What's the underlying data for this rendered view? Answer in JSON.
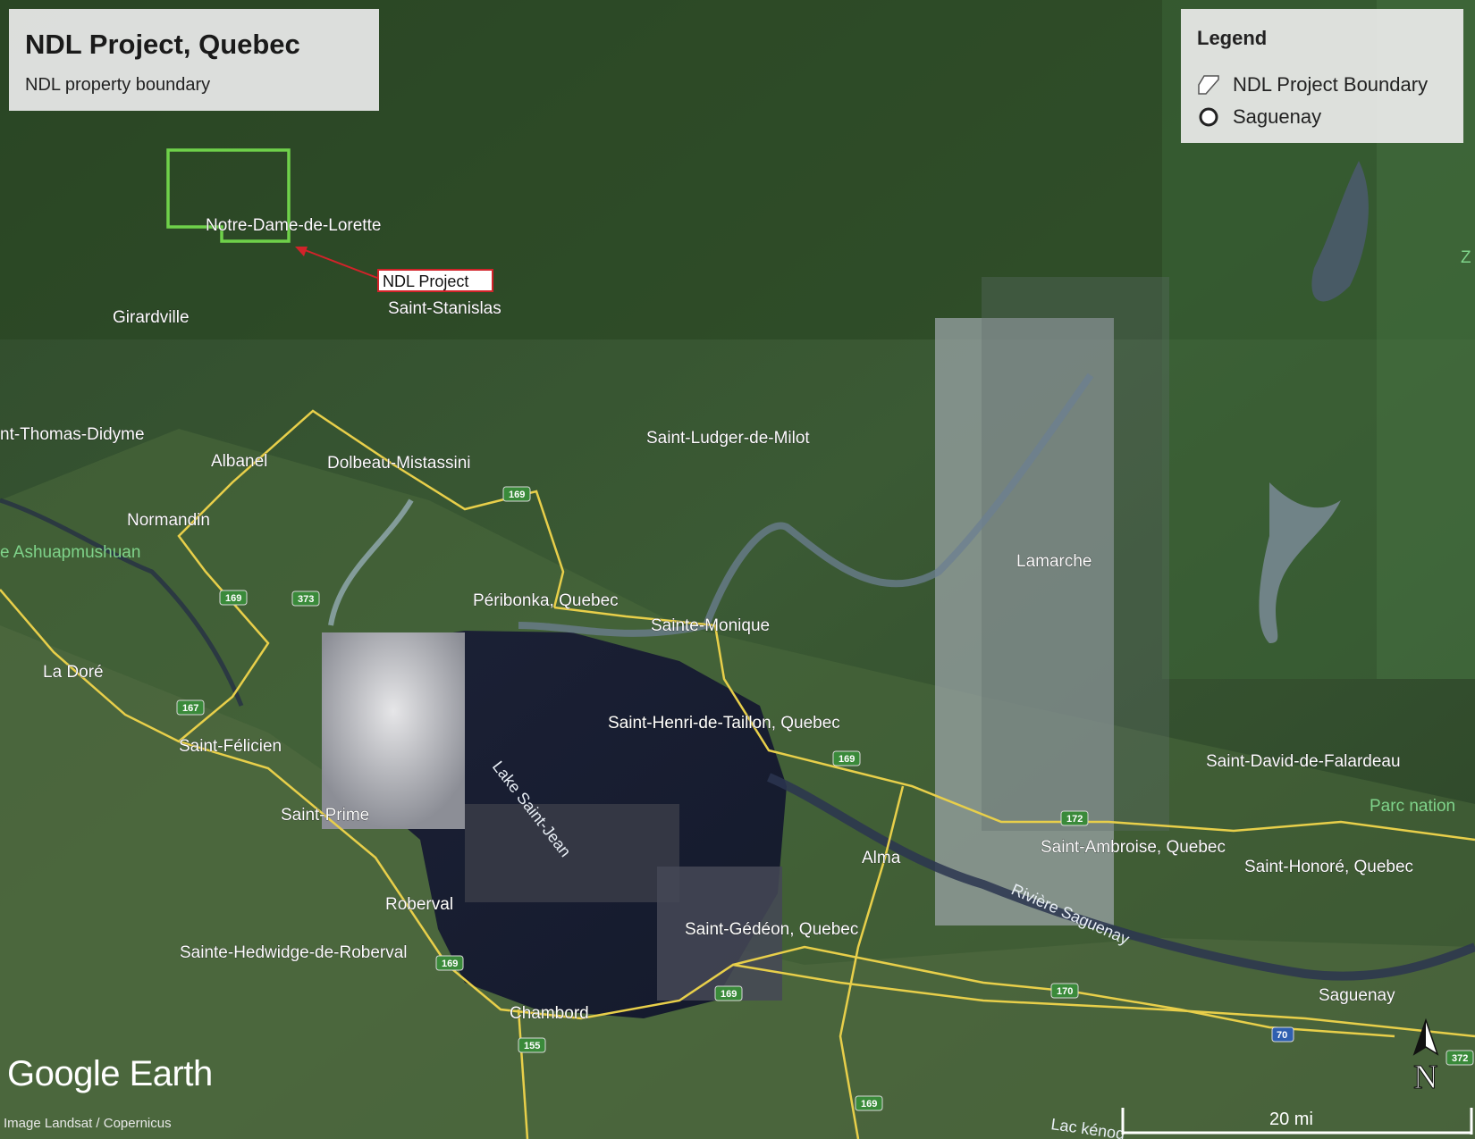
{
  "title": "NDL Project, Quebec",
  "subtitle": "NDL property boundary",
  "legend": {
    "title": "Legend",
    "items": [
      {
        "label": "NDL Project Boundary",
        "icon": "polygon-icon"
      },
      {
        "label": "Saguenay",
        "icon": "circle-marker-icon"
      }
    ]
  },
  "callout_label": "NDL Project",
  "places": {
    "notre_dame": "Notre-Dame-de-Lorette",
    "saint_stanislas": "Saint-Stanislas",
    "girardville": "Girardville",
    "thomas_didyme": "nt-Thomas-Didyme",
    "albanel": "Albanel",
    "dolbeau": "Dolbeau-Mistassini",
    "normandin": "Normandin",
    "ludger": "Saint-Ludger-de-Milot",
    "peribonka": "Péribonka, Quebec",
    "sainte_monique": "Sainte-Monique",
    "lamarche": "Lamarche",
    "la_dore": "La Doré",
    "saint_felicien": "Saint-Félicien",
    "saint_henri": "Saint-Henri-de-Taillon, Quebec",
    "saint_prime": "Saint-Prime",
    "saint_david": "Saint-David-de-Falardeau",
    "alma": "Alma",
    "saint_ambroise": "Saint-Ambroise, Quebec",
    "saint_honore": "Saint-Honoré, Quebec",
    "roberval": "Roberval",
    "saint_gedeon": "Saint-Gédéon, Quebec",
    "sainte_hedwidge": "Sainte-Hedwidge-de-Roberval",
    "chambord": "Chambord",
    "saguenay": "Saguenay",
    "lac_kenogami": "Lac kénog"
  },
  "water_labels": {
    "ashuapmushuan": "e Ashuapmushuan",
    "lake_saint_jean": "Lake Saint-Jean",
    "riviere_saguenay": "Rivière Saguenay",
    "parc": "Parc nation",
    "z": "Z"
  },
  "route_shields": [
    "169",
    "373",
    "169",
    "167",
    "169",
    "169",
    "172",
    "169",
    "170",
    "70",
    "155",
    "169",
    "372"
  ],
  "logo": "Google Earth",
  "imagery_credit": "Image Landsat / Copernicus",
  "scale_label": "20 mi",
  "north_label": "N",
  "colors": {
    "boundary": "#6fd14a",
    "callout": "#d2232a",
    "roads": "#e8cf4a"
  }
}
